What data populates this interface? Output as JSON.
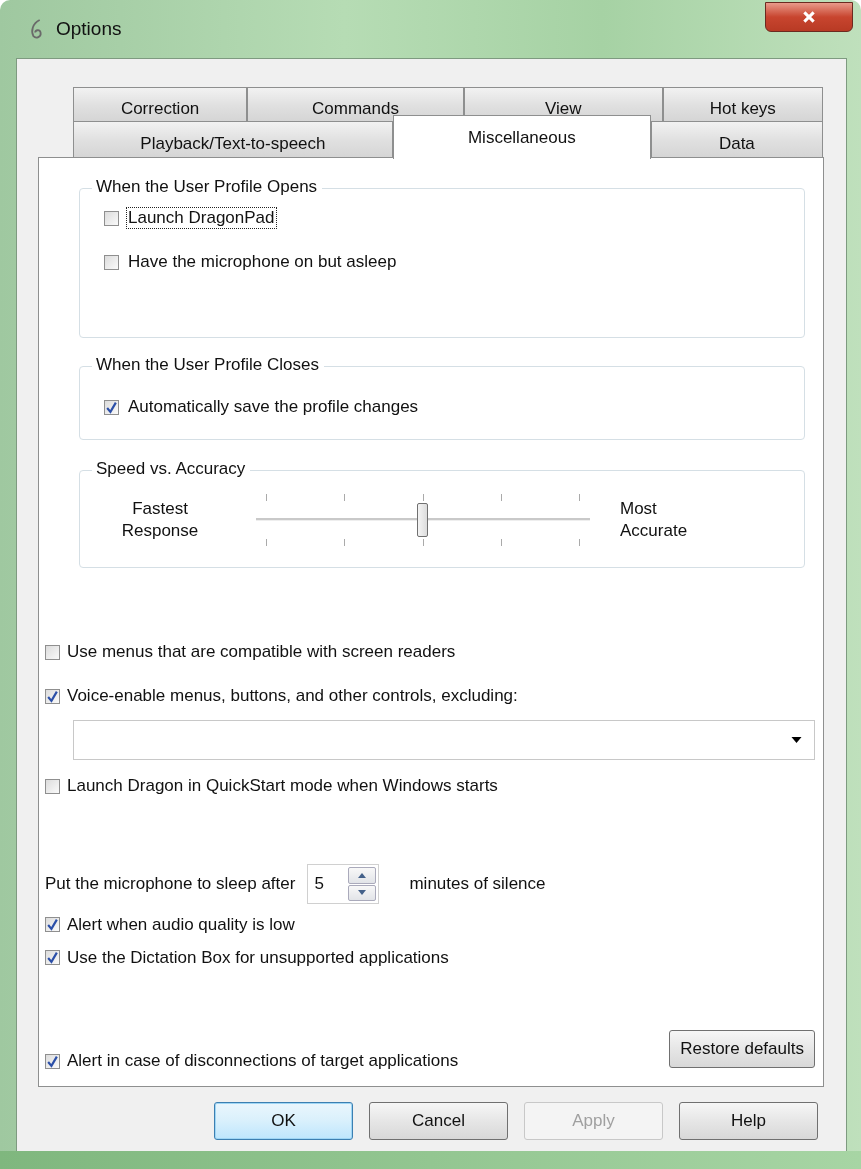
{
  "window": {
    "title": "Options"
  },
  "tab_rows": [
    {
      "tabs": [
        {
          "label": "Correction",
          "selected": false
        },
        {
          "label": "Commands",
          "selected": false
        },
        {
          "label": "View",
          "selected": false
        },
        {
          "label": "Hot keys",
          "selected": false
        }
      ]
    },
    {
      "tabs": [
        {
          "label": "Playback/Text-to-speech",
          "selected": false
        },
        {
          "label": "Miscellaneous",
          "selected": true
        },
        {
          "label": "Data",
          "selected": false
        }
      ]
    }
  ],
  "groups": [
    {
      "kind": "checks",
      "legend": "When the User Profile Opens",
      "items": [
        {
          "label": "Launch DragonPad",
          "checked": false,
          "focused": true
        },
        {
          "label": "Have the microphone on but asleep",
          "checked": false,
          "focused": false
        }
      ]
    },
    {
      "kind": "checks",
      "legend": "When the User Profile Closes",
      "items": [
        {
          "label": "Automatically save the profile changes",
          "checked": true,
          "focused": false
        }
      ]
    },
    {
      "kind": "slider",
      "legend": "Speed vs. Accuracy",
      "left_label": "Fastest Response",
      "right_label": "Most Accurate",
      "level": 0.5
    }
  ],
  "options": [
    {
      "kind": "checkbox",
      "label": "Use menus that are compatible with screen readers",
      "checked": false
    },
    {
      "kind": "checkbox",
      "label": "Voice-enable menus, buttons, and other controls, excluding:",
      "checked": true
    },
    {
      "kind": "dropdown"
    },
    {
      "kind": "checkbox",
      "label": "Launch Dragon in QuickStart mode when Windows starts",
      "checked": false
    },
    {
      "kind": "spin",
      "label": "Put the microphone to sleep after",
      "value": "5",
      "suffix": "minutes of silence"
    },
    {
      "kind": "checkbox",
      "label": "Alert when audio quality is low",
      "checked": true
    },
    {
      "kind": "checkbox",
      "label": "Use the Dictation Box for unsupported applications",
      "checked": true
    }
  ],
  "footer_option": {
    "label": "Alert in case of disconnections of target applications",
    "checked": true
  },
  "restore_button": {
    "label": "Restore defaults"
  },
  "buttons": [
    {
      "label": "OK",
      "default": true,
      "disabled": false
    },
    {
      "label": "Cancel",
      "default": false,
      "disabled": false
    },
    {
      "label": "Apply",
      "default": false,
      "disabled": true
    },
    {
      "label": "Help",
      "default": false,
      "disabled": false
    }
  ]
}
